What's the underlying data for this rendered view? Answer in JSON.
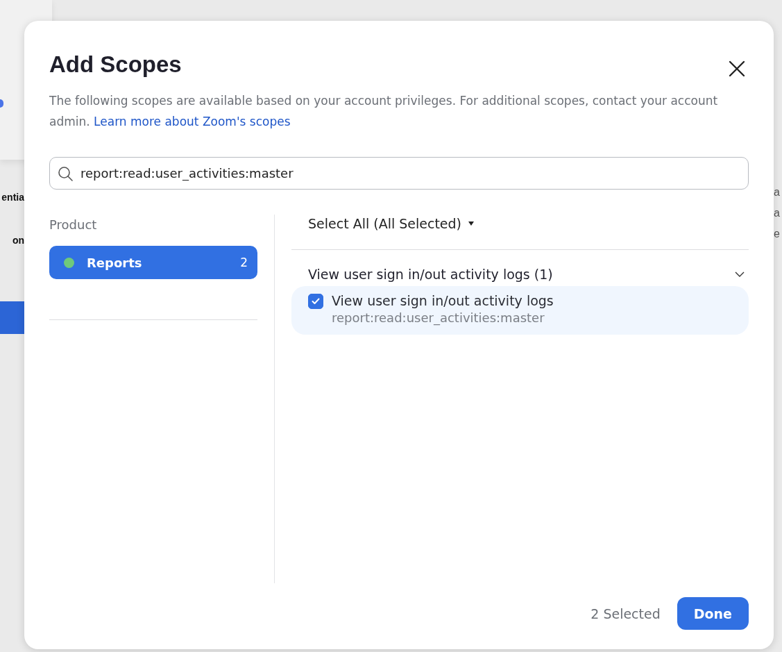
{
  "background": {
    "left_fragments": [
      "entia",
      "on"
    ],
    "right_fragments": [
      "a",
      "a",
      "e"
    ]
  },
  "dialog": {
    "title": "Add Scopes",
    "description": "The following scopes are available based on your account privileges. For additional scopes, contact your account admin.",
    "learn_more_link": "Learn more about Zoom's scopes",
    "search": {
      "value": "report:read:user_activities:master"
    },
    "product_heading": "Product",
    "products": [
      {
        "name": "Reports",
        "count": "2",
        "selected": true,
        "color": "#6fc97b"
      }
    ],
    "select_all": "Select All (All Selected)",
    "groups": [
      {
        "title": "View user sign in/out activity logs (1)",
        "expanded": true,
        "scopes": [
          {
            "label": "View user sign in/out activity logs",
            "value": "report:read:user_activities:master",
            "checked": true
          }
        ]
      }
    ],
    "selected_count": "2 Selected",
    "done_button": "Done"
  }
}
